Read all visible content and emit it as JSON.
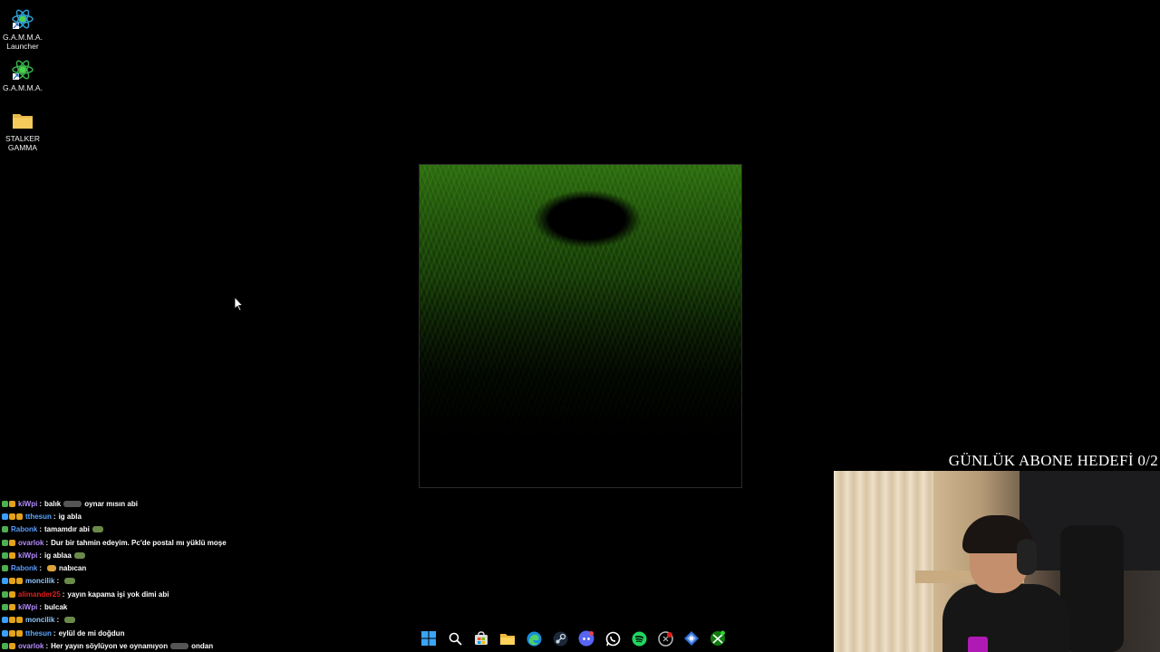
{
  "desktop": {
    "icons": [
      {
        "label": "G.A.M.M.A.\nLauncher",
        "icon": "gamma-launcher-icon"
      },
      {
        "label": "G.A.M.M.A.",
        "icon": "gamma-icon"
      },
      {
        "label": "STALKER\nGAMMA",
        "icon": "folder-icon"
      }
    ]
  },
  "overlay": {
    "subscriber_goal": "GÜNLÜK ABONE HEDEFİ 0/2"
  },
  "chat": {
    "messages": [
      {
        "user": "kiWpi",
        "user_color": "#b58cff",
        "text": "balık",
        "emote": true,
        "text2": "oynar mısın abi"
      },
      {
        "user": "tthesun",
        "user_color": "#5aa8ff",
        "text": "ig abla"
      },
      {
        "user": "Rabonk",
        "user_color": "#5a9cff",
        "text": "tamamdır abi",
        "emote_end": true
      },
      {
        "user": "ovarlok",
        "user_color": "#b58cff",
        "text": "Dur bir tahmin edeyim. Pc'de postal mı yüklü moşe"
      },
      {
        "user": "kiWpi",
        "user_color": "#b58cff",
        "text": "ig ablaa",
        "emote_end": true
      },
      {
        "user": "Rabonk",
        "user_color": "#5a9cff",
        "text": "nabıcan",
        "emote_start": true
      },
      {
        "user": "moncilik",
        "user_color": "#8ec6ff",
        "text": "",
        "emote_end": true
      },
      {
        "user": "alimander25",
        "user_color": "#e0201c",
        "text": "yayın kapama işi yok dimi abi"
      },
      {
        "user": "kiWpi",
        "user_color": "#b58cff",
        "text": "bulcak"
      },
      {
        "user": "moncilik",
        "user_color": "#8ec6ff",
        "text": "",
        "emote_end": true
      },
      {
        "user": "tthesun",
        "user_color": "#5aa8ff",
        "text": "eylül de mi doğdun"
      },
      {
        "user": "ovarlok",
        "user_color": "#b58cff",
        "text": "Her yayın söylüyon ve oynamıyon",
        "emote": true,
        "text2": "ondan"
      }
    ]
  },
  "taskbar": {
    "icons": [
      "windows-start-icon",
      "search-icon",
      "store-icon",
      "file-explorer-icon",
      "edge-icon",
      "steam-icon",
      "discord-icon",
      "whatsapp-icon",
      "spotify-icon",
      "riot-icon",
      "gamepad-icon",
      "xbox-icon"
    ]
  },
  "colors": {
    "desktop_bg": "#000000",
    "game_green": "#2f6b12",
    "badge_green": "#4caf50",
    "badge_gold": "#e3a21a",
    "badge_blue": "#3aa0ff"
  }
}
